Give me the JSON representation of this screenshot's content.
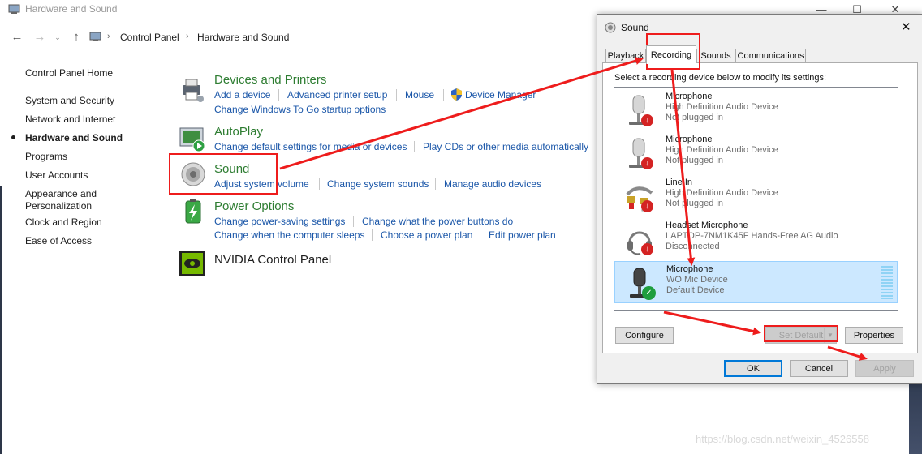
{
  "control_panel": {
    "window_title": "Hardware and Sound",
    "breadcrumb": [
      "Control Panel",
      "Hardware and Sound"
    ],
    "sidebar": [
      {
        "label": "Control Panel Home",
        "active": false
      },
      {
        "label": "System and Security",
        "active": false
      },
      {
        "label": "Network and Internet",
        "active": false
      },
      {
        "label": "Hardware and Sound",
        "active": true
      },
      {
        "label": "Programs",
        "active": false
      },
      {
        "label": "User Accounts",
        "active": false
      },
      {
        "label": "Appearance and Personalization",
        "active": false
      },
      {
        "label": "Clock and Region",
        "active": false
      },
      {
        "label": "Ease of Access",
        "active": false
      }
    ],
    "categories": {
      "devices": {
        "title": "Devices and Printers",
        "tasks": [
          "Add a device",
          "Advanced printer setup",
          "Mouse",
          "Device Manager",
          "Change Windows To Go startup options"
        ]
      },
      "autoplay": {
        "title": "AutoPlay",
        "tasks": [
          "Change default settings for media or devices",
          "Play CDs or other media automatically"
        ]
      },
      "sound": {
        "title": "Sound",
        "tasks": [
          "Adjust system volume",
          "Change system sounds",
          "Manage audio devices"
        ]
      },
      "power": {
        "title": "Power Options",
        "tasks": [
          "Change power-saving settings",
          "Change what the power buttons do",
          "Change when the computer sleeps",
          "Choose a power plan",
          "Edit power plan"
        ]
      },
      "nvidia": {
        "title": "NVIDIA Control Panel"
      }
    }
  },
  "sound_dialog": {
    "title": "Sound",
    "tabs": [
      "Playback",
      "Recording",
      "Sounds",
      "Communications"
    ],
    "selected_tab": "Recording",
    "instruction": "Select a recording device below to modify its settings:",
    "devices": [
      {
        "name": "Microphone",
        "driver": "High Definition Audio Device",
        "status": "Not plugged in"
      },
      {
        "name": "Microphone",
        "driver": "High Definition Audio Device",
        "status": "Not plugged in"
      },
      {
        "name": "Line In",
        "driver": "High Definition Audio Device",
        "status": "Not plugged in"
      },
      {
        "name": "Headset Microphone",
        "driver": "LAPTOP-7NM1K45F Hands-Free AG Audio",
        "status": "Disconnected"
      },
      {
        "name": "Microphone",
        "driver": "WO Mic Device",
        "status": "Default Device"
      }
    ],
    "buttons": {
      "configure": "Configure",
      "set_default": "Set Default",
      "properties": "Properties",
      "ok": "OK",
      "cancel": "Cancel",
      "apply": "Apply"
    }
  },
  "watermark": "https://blog.csdn.net/weixin_4526558",
  "colors": {
    "accent_red": "#ee1c1c",
    "link_blue": "#1a56a8",
    "category_green": "#2e7d32",
    "selection_blue": "#cce8ff"
  }
}
